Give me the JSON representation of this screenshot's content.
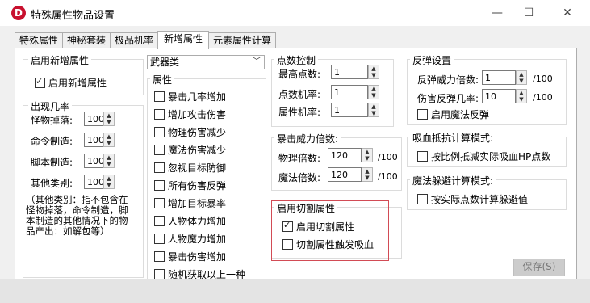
{
  "window": {
    "title": "特殊属性物品设置",
    "app_icon": "D"
  },
  "tabs": [
    "特殊属性",
    "神秘套装",
    "极品机率",
    "新增属性",
    "元素属性计算"
  ],
  "enable_group": {
    "label": "启用新增属性",
    "checkbox": "启用新增属性"
  },
  "chance_group": {
    "label": "出现几率",
    "rows": [
      {
        "label": "怪物掉落:",
        "value": "100"
      },
      {
        "label": "命令制造:",
        "value": "100"
      },
      {
        "label": "脚本制造:",
        "value": "100"
      },
      {
        "label": "其他类别:",
        "value": "100"
      }
    ],
    "note": [
      "（其他类别：指不包含在",
      "怪物掉落，命令制造，脚",
      "本制造的其他情况下的物",
      "品产出：如解包等）"
    ]
  },
  "type_select": {
    "value": "武器类"
  },
  "attr_group": {
    "label": "属性",
    "items": [
      {
        "label": "暴击几率增加",
        "checked": false
      },
      {
        "label": "增加攻击伤害",
        "checked": false
      },
      {
        "label": "物理伤害减少",
        "checked": false
      },
      {
        "label": "魔法伤害减少",
        "checked": false
      },
      {
        "label": "忽视目标防御",
        "checked": false
      },
      {
        "label": "所有伤害反弹",
        "checked": false
      },
      {
        "label": "增加目标暴率",
        "checked": false
      },
      {
        "label": "人物体力增加",
        "checked": false
      },
      {
        "label": "人物魔力增加",
        "checked": false
      },
      {
        "label": "暴击伤害增加",
        "checked": false
      },
      {
        "label": "随机获取以上一种",
        "checked": false
      }
    ]
  },
  "points_group": {
    "label": "点数控制",
    "rows": [
      {
        "label": "最高点数:",
        "value": "1"
      },
      {
        "label": "点数机率:",
        "value": "1"
      },
      {
        "label": "属性机率:",
        "value": "1"
      }
    ]
  },
  "crit_group": {
    "label": "暴击威力倍数:",
    "rows": [
      {
        "label": "物理倍数:",
        "value": "120",
        "unit": "/100"
      },
      {
        "label": "魔法倍数:",
        "value": "120",
        "unit": "/100"
      }
    ]
  },
  "cut_group": {
    "label": "启用切割属性",
    "items": [
      {
        "label": "启用切割属性",
        "checked": true
      },
      {
        "label": "切割属性触发吸血",
        "checked": false
      }
    ]
  },
  "rebound_group": {
    "label": "反弹设置",
    "rows": [
      {
        "label": "反弹威力倍数:",
        "value": "1",
        "unit": "/100"
      },
      {
        "label": "伤害反弹几率:",
        "value": "10",
        "unit": "/100"
      }
    ],
    "checkbox": "启用魔法反弹"
  },
  "absorb_group": {
    "label": "吸血抵抗计算模式:",
    "checkbox": "按比例抵减实际吸血HP点数"
  },
  "dodge_group": {
    "label": "魔法躲避计算模式:",
    "checkbox": "按实际点数计算躲避值"
  },
  "buttons": {
    "save": "保存(S)"
  },
  "colors": {
    "accent": "#c8102e",
    "highlight": "#d24b55"
  }
}
